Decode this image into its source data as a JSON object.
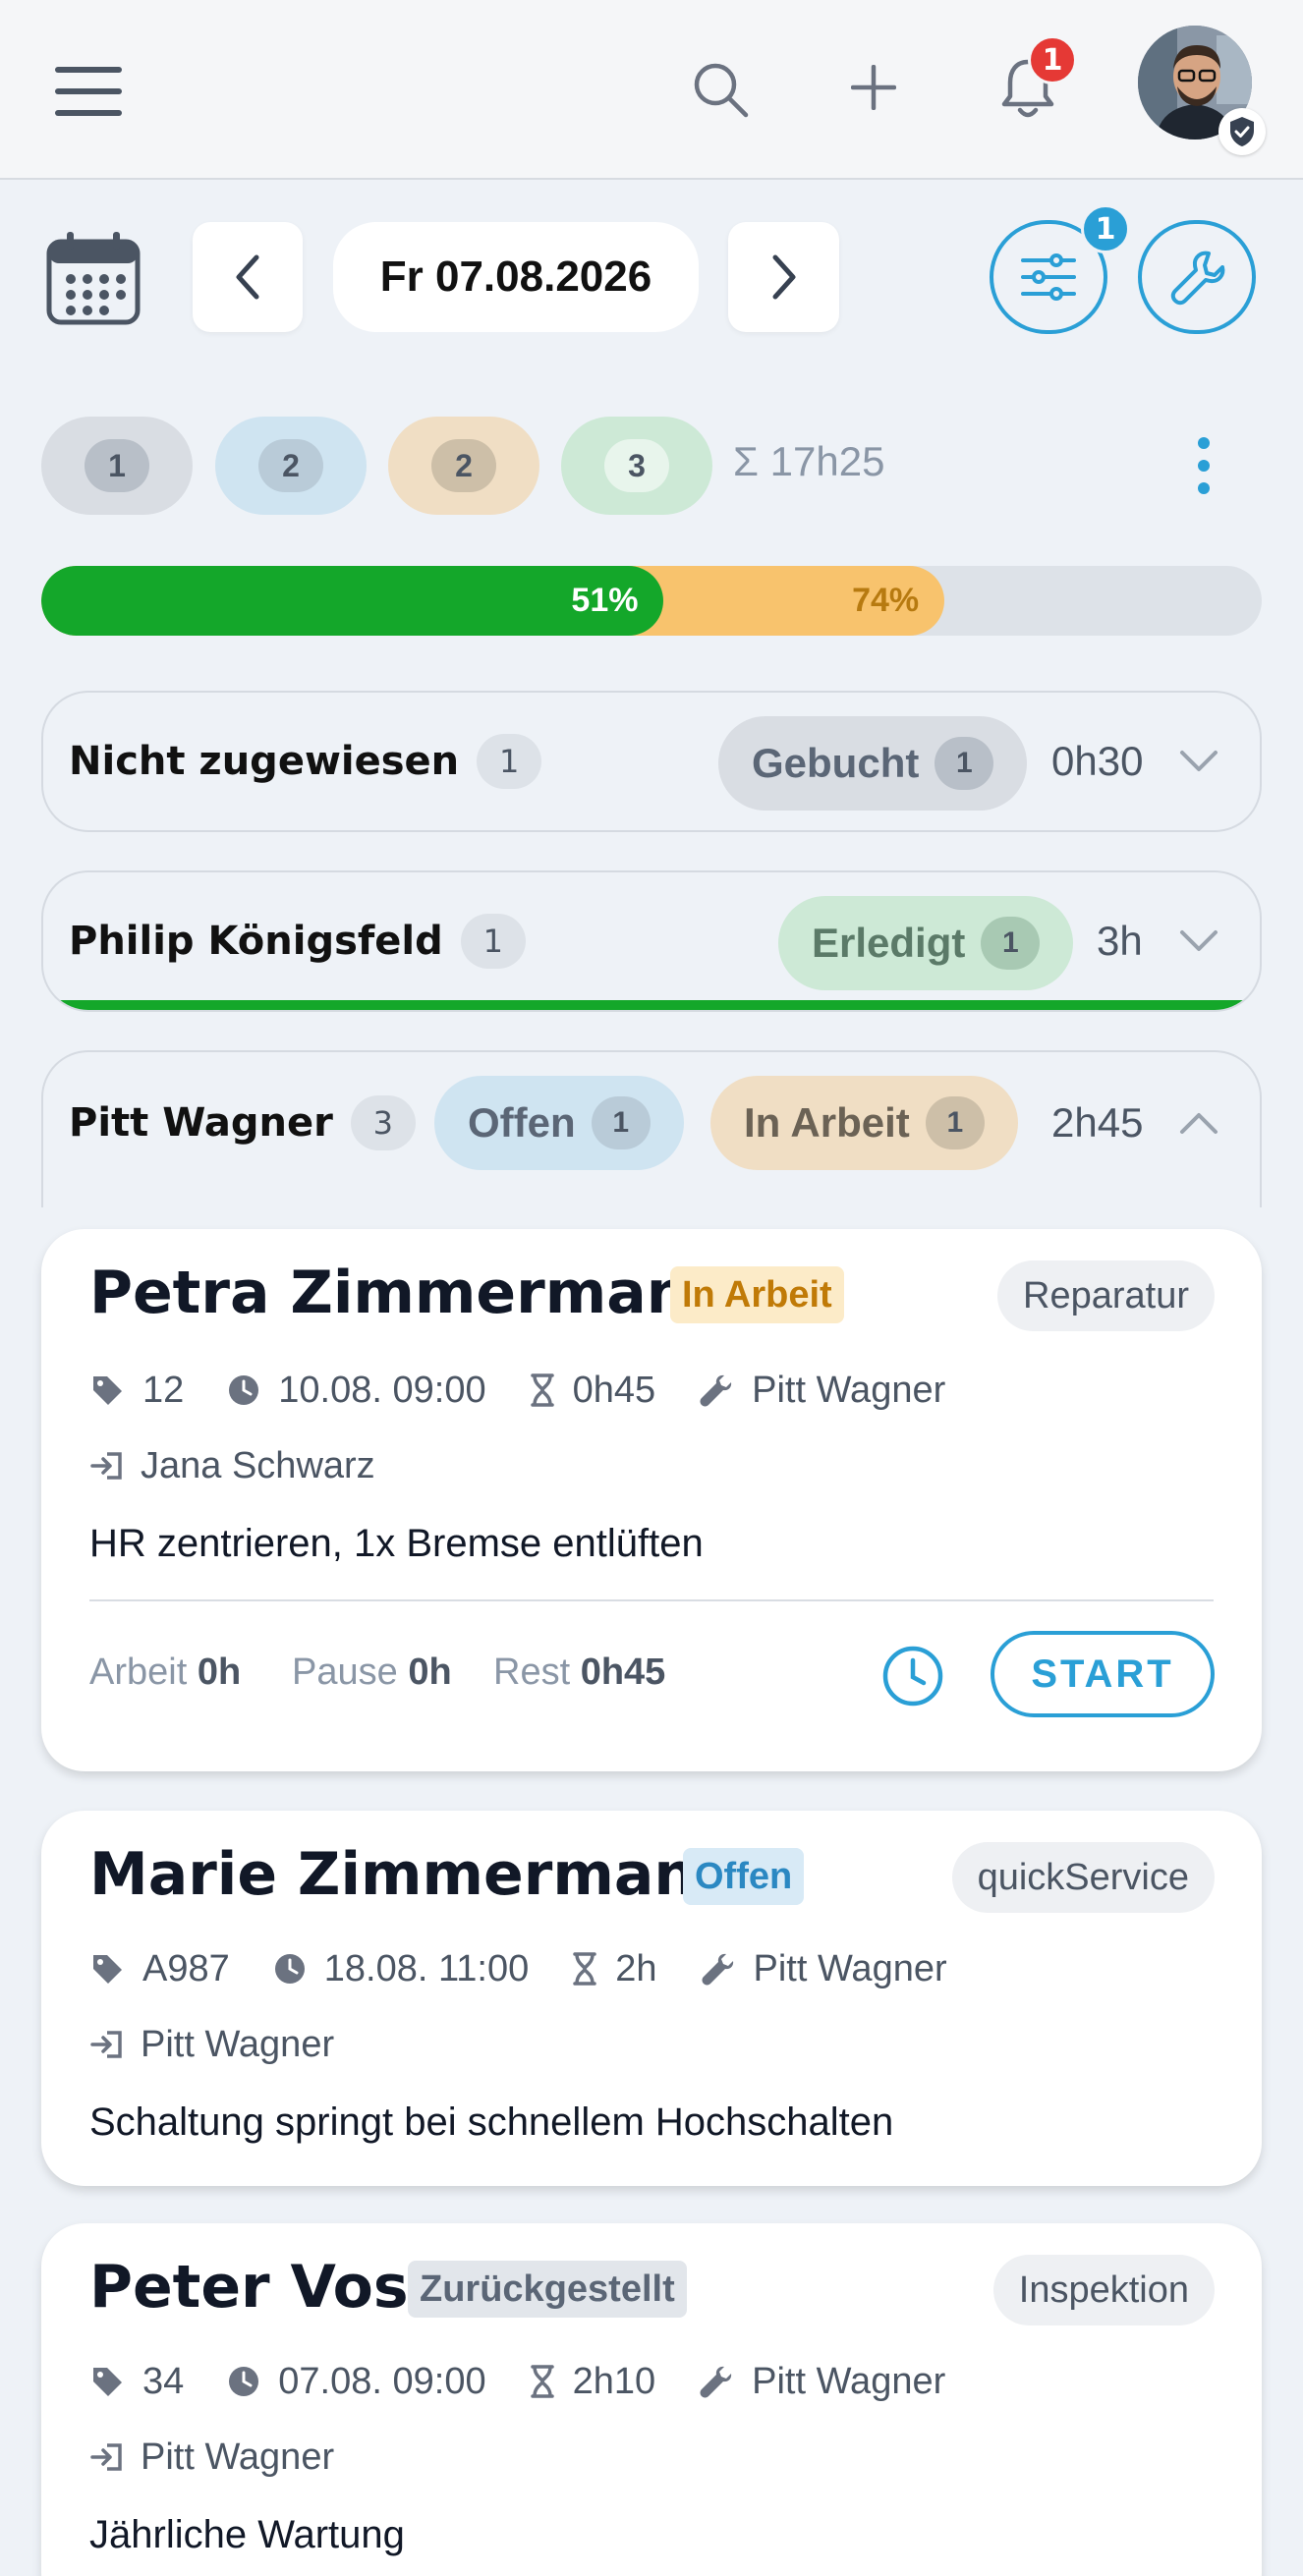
{
  "topbar": {
    "menu_icon": "hamburger-menu-icon",
    "search_icon": "search-icon",
    "add_icon": "plus-icon",
    "notification_icon": "bell-icon",
    "notification_count": "1",
    "avatar_badge_icon": "shield-check-icon"
  },
  "datebar": {
    "calendar_icon": "calendar-icon",
    "date_label": "Fr 07.08.2026",
    "filter_count": "1",
    "filter_icon": "sliders-icon",
    "tools_icon": "wrench-icon"
  },
  "counts": [
    {
      "value": "1",
      "color": "#d7dbe1",
      "inner": "#b8bfc8"
    },
    {
      "value": "2",
      "color": "#cfe4f1",
      "inner": "#b8c9d6"
    },
    {
      "value": "2",
      "color": "#f0dec4",
      "inner": "#cdbfa8"
    },
    {
      "value": "3",
      "color": "#cde9d6",
      "inner": "#e8f5ec"
    }
  ],
  "total_time": "Σ 17h25",
  "progress": {
    "done": 0.51,
    "done_label": "51%",
    "working": 0.74,
    "working_label": "74%"
  },
  "groups": [
    {
      "name": "Nicht zugewiesen",
      "count": "1",
      "statuses": [
        {
          "label": "Gebucht",
          "count": "1"
        }
      ],
      "time": "0h30",
      "expanded": false
    },
    {
      "name": "Philip Königsfeld",
      "count": "1",
      "statuses": [
        {
          "label": "Erledigt",
          "count": "1"
        }
      ],
      "time": "3h",
      "expanded": false
    },
    {
      "name": "Pitt Wagner",
      "count": "3",
      "statuses": [
        {
          "label": "Offen",
          "count": "1"
        },
        {
          "label": "In Arbeit",
          "count": "1"
        }
      ],
      "time": "2h45",
      "expanded": true
    }
  ],
  "cards": [
    {
      "customer": "Petra Zimmermann",
      "status": "In Arbeit",
      "type": "Reparatur",
      "number": "12",
      "datetime": "10.08. 09:00",
      "duration": "0h45",
      "mechanic": "Pitt Wagner",
      "assigned_by": "Jana Schwarz",
      "description": "HR zentrieren, 1x Bremse entlüften",
      "work_label": "Arbeit",
      "work_value": "0h",
      "pause_label": "Pause",
      "pause_value": "0h",
      "rest_label": "Rest",
      "rest_value": "0h45",
      "start_label": "START"
    },
    {
      "customer": "Marie Zimmermann",
      "status": "Offen",
      "type": "quickService",
      "number": "A987",
      "datetime": "18.08. 11:00",
      "duration": "2h",
      "mechanic": "Pitt Wagner",
      "assigned_by": "Pitt Wagner",
      "description": "Schaltung springt bei schnellem Hochschalten"
    },
    {
      "customer": "Peter Voss",
      "status": "Zurückgestellt",
      "type": "Inspektion",
      "number": "34",
      "datetime": "07.08. 09:00",
      "duration": "2h10",
      "mechanic": "Pitt Wagner",
      "assigned_by": "Pitt Wagner",
      "description": "Jährliche Wartung"
    }
  ]
}
